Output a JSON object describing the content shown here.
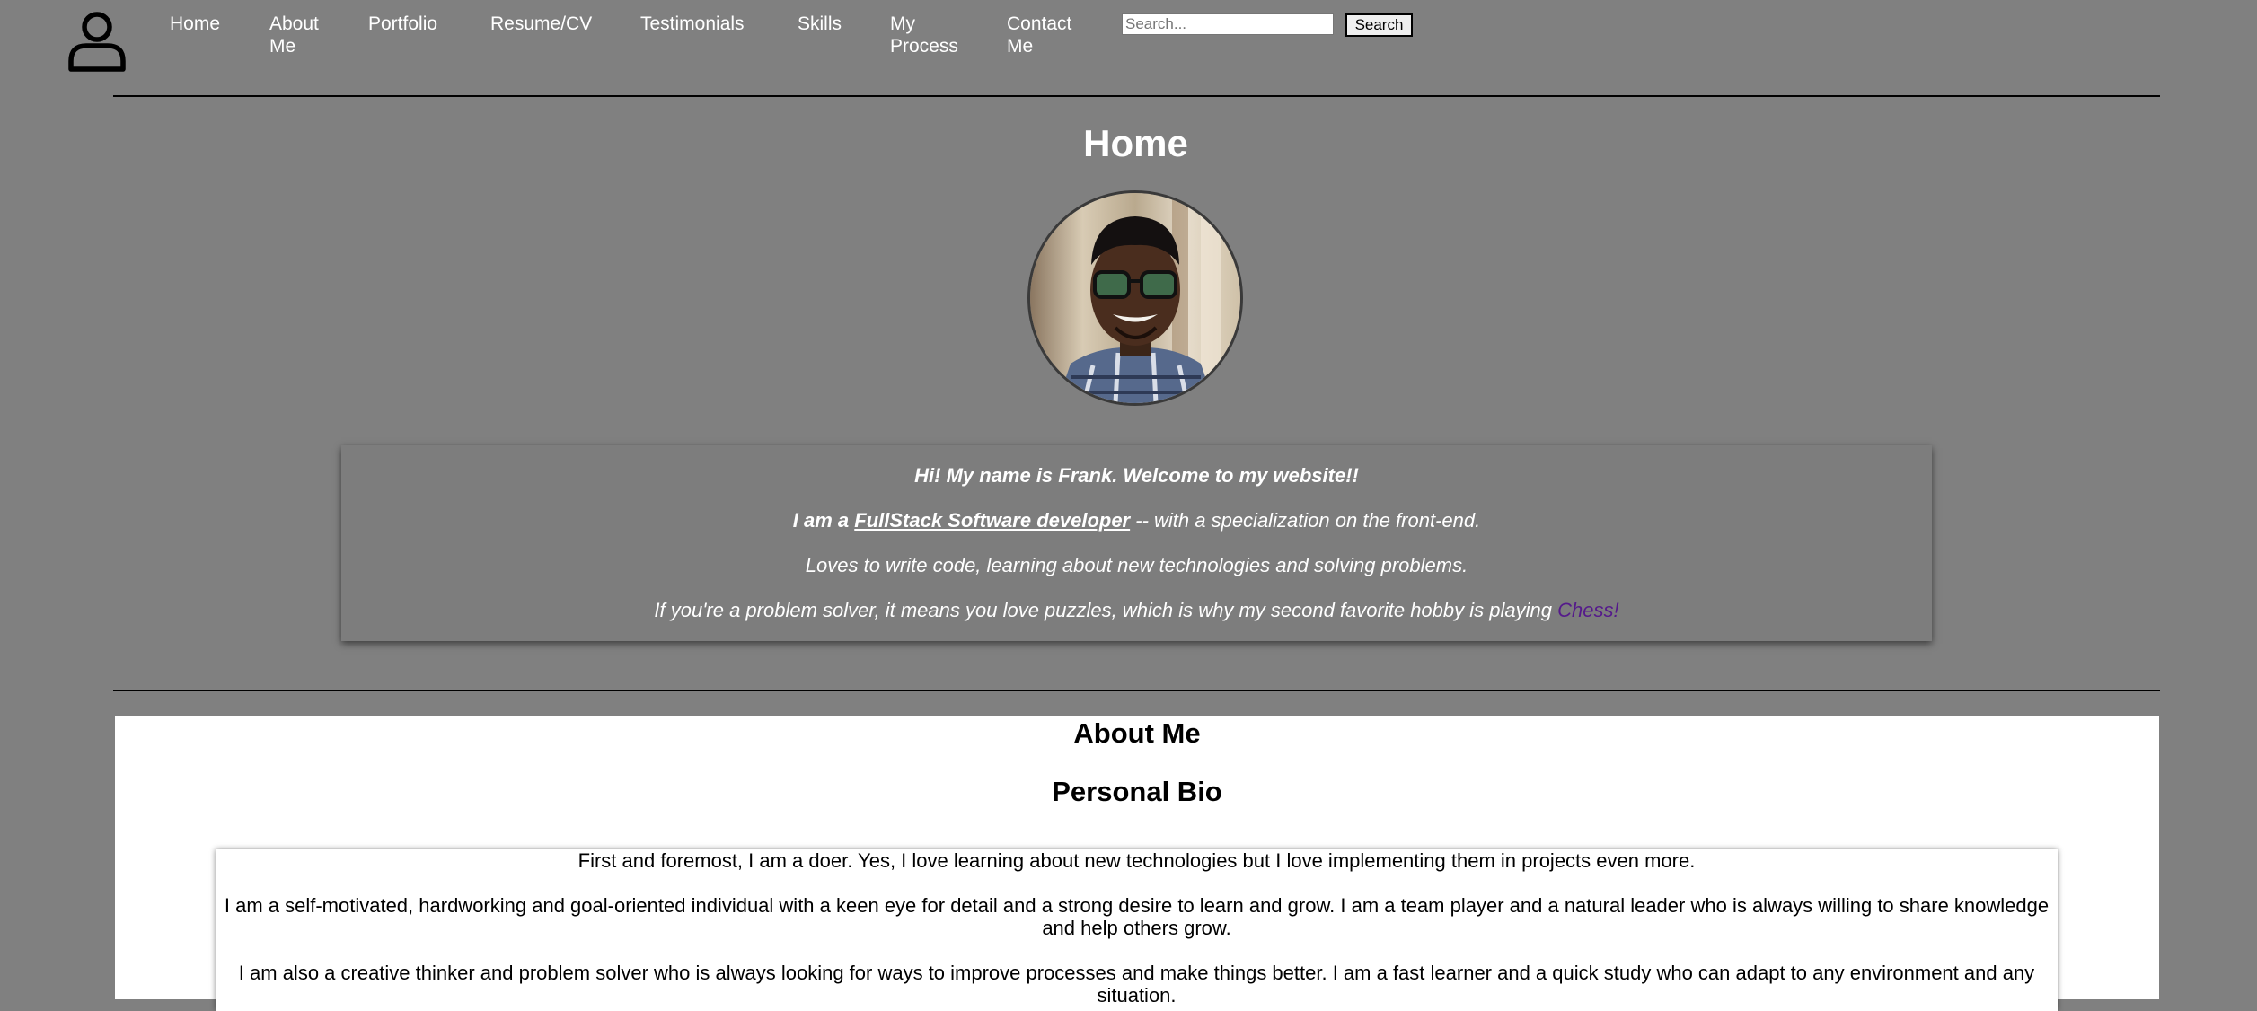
{
  "header": {
    "logo_icon": "user-icon",
    "nav": [
      {
        "label": "Home"
      },
      {
        "label": "About\nMe"
      },
      {
        "label": "Portfolio"
      },
      {
        "label": "Resume/CV"
      },
      {
        "label": "Testimonials"
      },
      {
        "label": "Skills"
      },
      {
        "label": "My\nProcess"
      },
      {
        "label": "Contact\nMe"
      }
    ],
    "search": {
      "placeholder": "Search...",
      "value": "",
      "button_label": "Search"
    }
  },
  "home": {
    "title": "Home",
    "intro": {
      "greeting": "Hi! My name is Frank. Welcome to my website!!",
      "role_prefix": "I am a ",
      "role_link": "FullStack Software developer",
      "role_suffix": " -- with a specialization on the front-end.",
      "interests": "Loves to write code, learning about new technologies and solving problems.",
      "hobby_text": "If you're a problem solver, it means you love puzzles, which is why my second favorite hobby is playing ",
      "hobby_link": "Chess!"
    }
  },
  "about": {
    "title": "About Me",
    "bio_title": "Personal Bio",
    "paragraphs": [
      "First and foremost, I am a doer. Yes, I love learning about new technologies but I love implementing them in projects even more.",
      "I am a self-motivated, hardworking and goal-oriented individual with a keen eye for detail and a strong desire to learn and grow. I am a team player and a natural leader who is always willing to share knowledge and help others grow.",
      "I am also a creative thinker and problem solver who is always looking for ways to improve processes and make things better. I am a fast learner and a quick study who can adapt to any environment and any situation."
    ]
  },
  "colors": {
    "page_background": "#808080",
    "divider": "#000000",
    "link_visited": "#551a8b",
    "section_background": "#ffffff"
  }
}
